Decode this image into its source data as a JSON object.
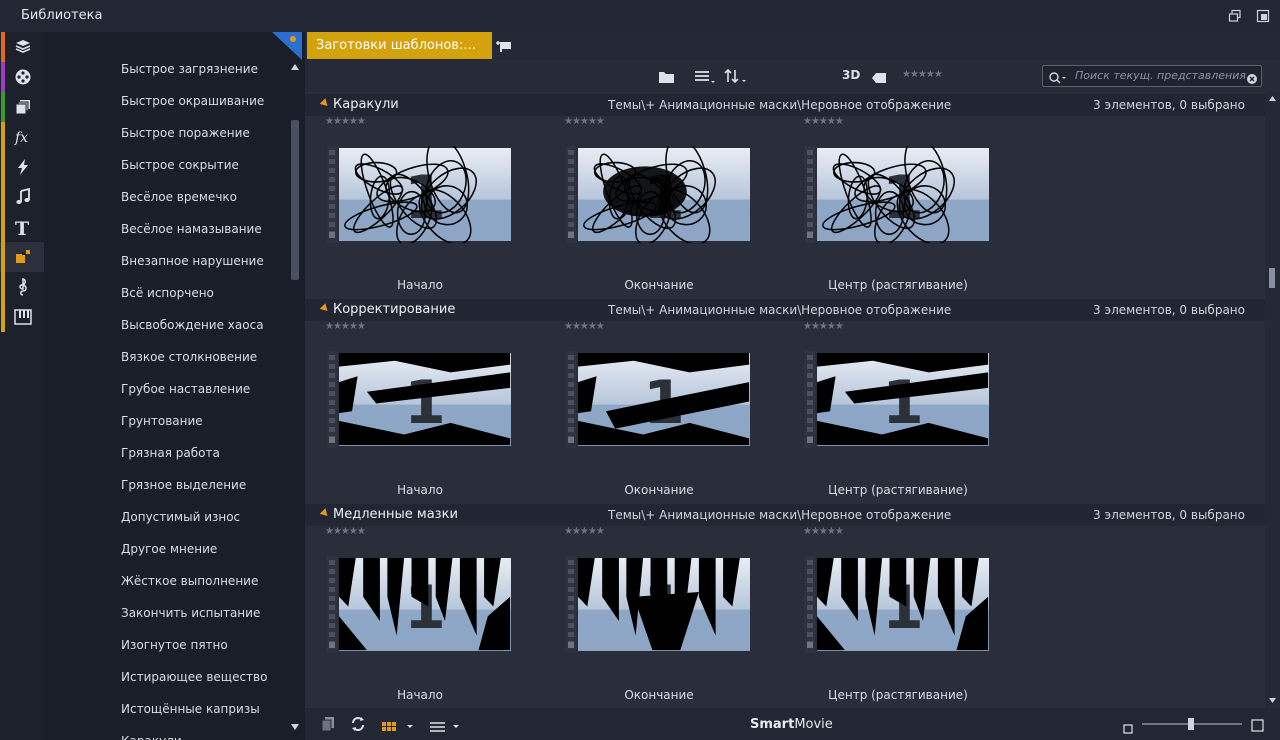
{
  "window": {
    "title": "Библиотека"
  },
  "tree": {
    "items": [
      "Быстрое загрязнение",
      "Быстрое окрашивание",
      "Быстрое поражение",
      "Быстрое сокрытие",
      "Весёлое времечко",
      "Весёлое намазывание",
      "Внезапное нарушение",
      "Всё испорчено",
      "Высвобождение хаоса",
      "Вязкое столкновение",
      "Грубое наставление",
      "Грунтование",
      "Грязная работа",
      "Грязное выделение",
      "Допустимый износ",
      "Другое мнение",
      "Жёсткое выполнение",
      "Закончить испытание",
      "Изогнутое пятно",
      "Истирающее вещество",
      "Истощённые капризы",
      "Каракули"
    ]
  },
  "rail": {
    "items": [
      {
        "icon": "project-box-icon",
        "color": "#e06a1a"
      },
      {
        "icon": "film-reel-icon",
        "color": "#9a3fc4"
      },
      {
        "icon": "stack-icon",
        "color": "#3a9a2a"
      },
      {
        "icon": "fx-icon",
        "color": "#d4a20c"
      },
      {
        "icon": "lightning-icon",
        "color": "#d4a20c"
      },
      {
        "icon": "music-note-icon",
        "color": "#d4a20c"
      },
      {
        "icon": "title-text-icon",
        "color": "#d4a20c"
      },
      {
        "icon": "mask-icon",
        "color": "#d4a20c"
      },
      {
        "icon": "treble-clef-icon",
        "color": "#d4a20c"
      },
      {
        "icon": "piano-icon",
        "color": "#d4a20c"
      }
    ]
  },
  "tab": {
    "label": "Заготовки шаблонов:..."
  },
  "toolbar": {
    "view3d": "3D",
    "stars": "★★★★★"
  },
  "search": {
    "placeholder": "Поиск текущ. представления"
  },
  "groups": [
    {
      "name": "Каракули",
      "path": "Темы\\+ Анимационные маски\\Неровное отображение",
      "count": "3 элементов, 0 выбрано",
      "items": [
        "Начало",
        "Окончание",
        "Центр (растягивание)"
      ]
    },
    {
      "name": "Корректирование",
      "path": "Темы\\+ Анимационные маски\\Неровное отображение",
      "count": "3 элементов, 0 выбрано",
      "items": [
        "Начало",
        "Окончание",
        "Центр (растягивание)"
      ]
    },
    {
      "name": "Медленные мазки",
      "path": "Темы\\+ Анимационные маски\\Неровное отображение",
      "count": "3 элементов, 0 выбрано",
      "items": [
        "Начало",
        "Окончание",
        "Центр (растягивание)"
      ]
    }
  ],
  "thumbnail": {
    "digit": "1"
  },
  "bottom": {
    "brand_bold": "Smart",
    "brand_rest": "Movie"
  },
  "colors": {
    "accent": "#d4a20c",
    "orange": "#e39a1a"
  }
}
